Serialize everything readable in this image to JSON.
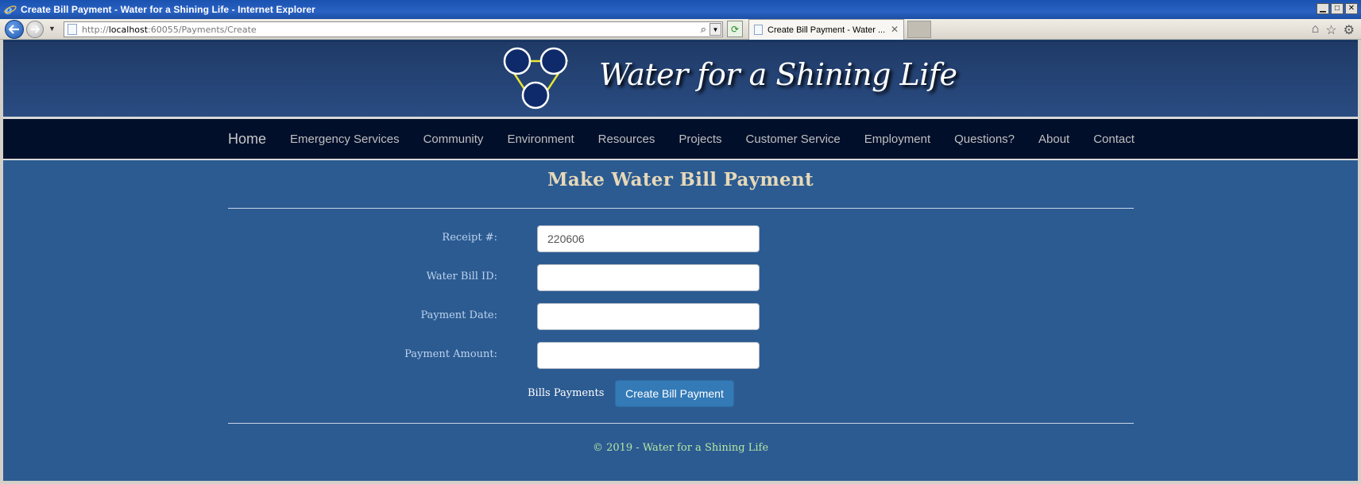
{
  "window": {
    "title": "Create Bill Payment - Water for a Shining Life - Internet Explorer"
  },
  "browser": {
    "url_prefix": "http://",
    "url_host": "localhost",
    "url_rest": ":60055/Payments/Create",
    "tab_title": "Create Bill Payment - Water ..."
  },
  "site": {
    "title": "Water for a Shining Life"
  },
  "nav": {
    "brand": "Home",
    "items": [
      "Emergency Services",
      "Community",
      "Environment",
      "Resources",
      "Projects",
      "Customer Service",
      "Employment",
      "Questions?",
      "About",
      "Contact"
    ]
  },
  "page": {
    "heading": "Make Water Bill Payment"
  },
  "form": {
    "receipt_label": "Receipt #:",
    "receipt_value": "220606",
    "bill_id_label": "Water Bill ID:",
    "bill_id_value": "",
    "payment_date_label": "Payment Date:",
    "payment_date_value": "",
    "payment_amount_label": "Payment Amount:",
    "payment_amount_value": "",
    "bills_link": "Bills Payments",
    "submit_label": "Create Bill Payment"
  },
  "footer": {
    "text": "© 2019 - Water for a Shining Life"
  },
  "colors": {
    "header_bg": "#1f3a67",
    "nav_bg": "#020f2b",
    "content_bg": "#2c5b92",
    "heading": "#e6d9b8",
    "footer_text": "#b5e6a2",
    "button": "#337ab7"
  }
}
